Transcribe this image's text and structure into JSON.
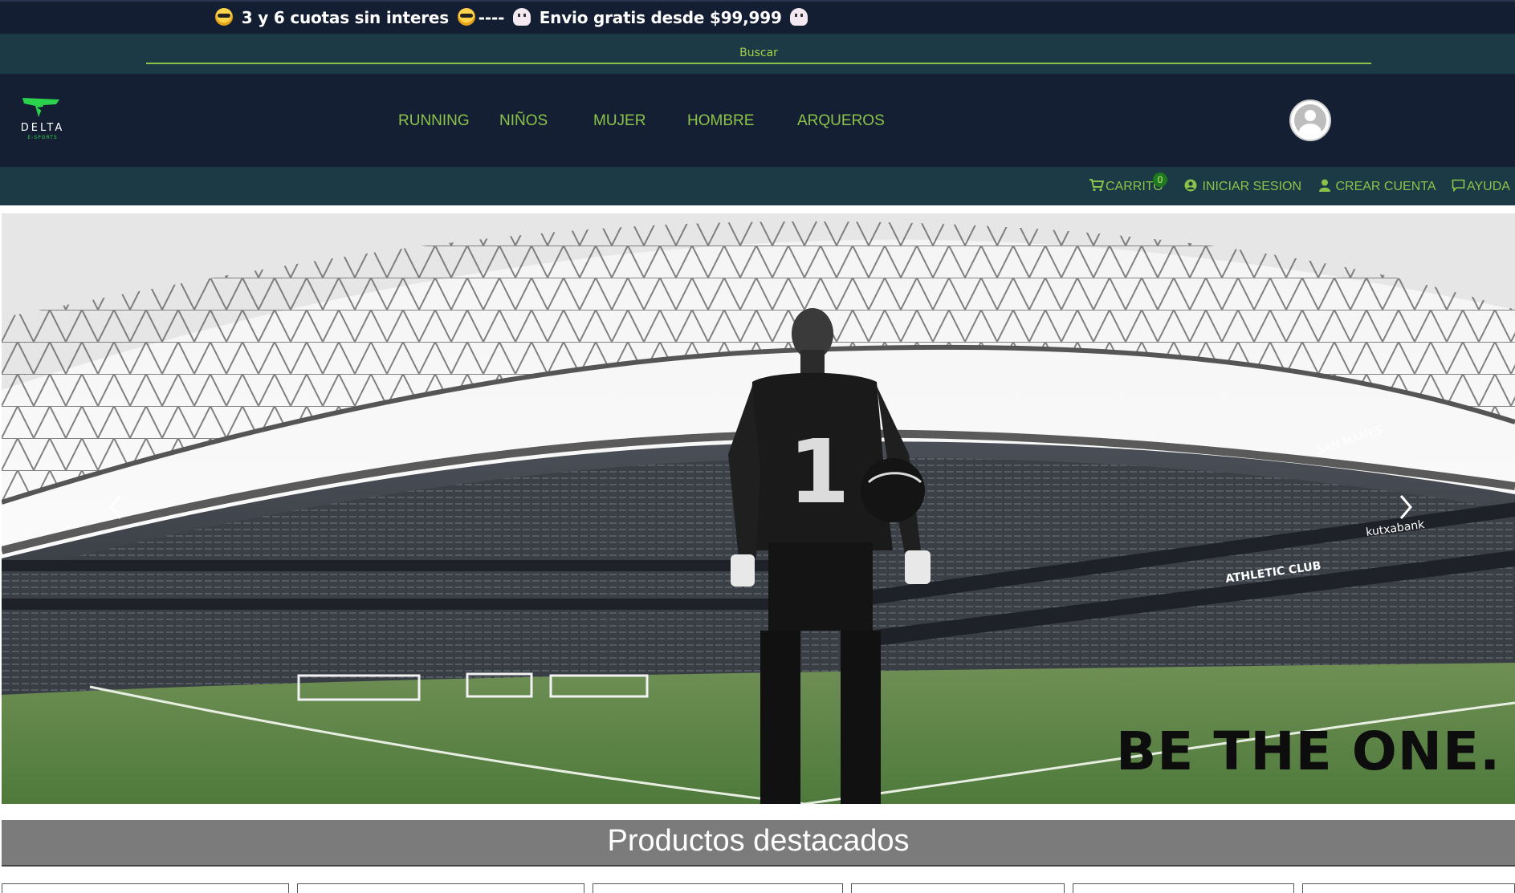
{
  "promo": {
    "text_1": "3 y 6 cuotas sin interes",
    "separator": "----",
    "text_2": "Envio gratis desde $99,999"
  },
  "search": {
    "placeholder": "Buscar"
  },
  "brand": {
    "name": "DELTA",
    "tagline": "E-SPORTS",
    "accent": "#2bd24d"
  },
  "nav": {
    "items": [
      {
        "label": "RUNNING"
      },
      {
        "label": "NIÑOS"
      },
      {
        "label": "MUJER"
      },
      {
        "label": "HOMBRE"
      },
      {
        "label": "ARQUEROS"
      }
    ]
  },
  "subnav": {
    "cart_label": "CARRITO",
    "cart_count": "0",
    "login_label": "INICIAR SESION",
    "register_label": "CREAR CUENTA",
    "help_label": "AYUDA"
  },
  "hero": {
    "slogan": "BE THE ONE.",
    "jersey_number": "1",
    "stand_signs": [
      "SAN MAMES",
      "ATHLETIC CLUB",
      "kutxabank"
    ],
    "icons": [
      "chevron-left-icon",
      "chevron-right-icon"
    ]
  },
  "featured": {
    "title": "Productos destacados"
  },
  "colors": {
    "accent": "#8bc34a",
    "nav_bg": "#141f33",
    "bar_bg": "#1b3a45"
  }
}
